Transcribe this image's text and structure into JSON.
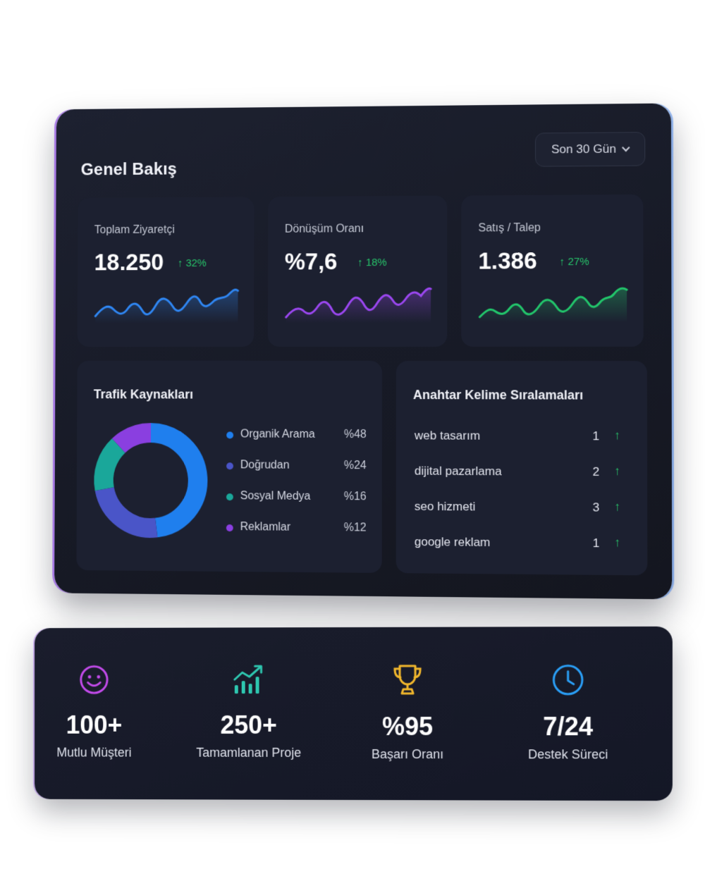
{
  "overview": {
    "title": "Genel Bakış",
    "range_label": "Son 30 Gün"
  },
  "kpis": [
    {
      "label": "Toplam Ziyaretçi",
      "value": "18.250",
      "delta": "↑ 32%",
      "color": "#2f86f2"
    },
    {
      "label": "Dönüşüm Oranı",
      "value": "%7,6",
      "delta": "↑ 18%",
      "color": "#9b47f0"
    },
    {
      "label": "Satış / Talep",
      "value": "1.386",
      "delta": "↑ 27%",
      "color": "#22c56b"
    }
  ],
  "traffic": {
    "title": "Trafik Kaynakları",
    "sources": [
      {
        "name": "Organik Arama",
        "pct": "%48",
        "share": 48,
        "color": "#1f7fee"
      },
      {
        "name": "Doğrudan",
        "pct": "%24",
        "share": 24,
        "color": "#4a55c8"
      },
      {
        "name": "Sosyal Medya",
        "pct": "%16",
        "share": 16,
        "color": "#1aa79a"
      },
      {
        "name": "Reklamlar",
        "pct": "%12",
        "share": 12,
        "color": "#8a3fe0"
      }
    ]
  },
  "keywords": {
    "title": "Anahtar Kelime Sıralamaları",
    "rows": [
      {
        "keyword": "web tasarım",
        "rank": "1",
        "trend": "↑"
      },
      {
        "keyword": "dijital pazarlama",
        "rank": "2",
        "trend": "↑"
      },
      {
        "keyword": "seo hizmeti",
        "rank": "3",
        "trend": "↑"
      },
      {
        "keyword": "google reklam",
        "rank": "1",
        "trend": "↑"
      }
    ]
  },
  "stats": [
    {
      "value": "100+",
      "caption": "Mutlu Müşteri",
      "icon": "smiley-icon",
      "color": "#c04ae8"
    },
    {
      "value": "250+",
      "caption": "Tamamlanan Proje",
      "icon": "growth-chart-icon",
      "color": "#2ec7b0"
    },
    {
      "value": "%95",
      "caption": "Başarı Oranı",
      "icon": "trophy-icon",
      "color": "#f1b72c"
    },
    {
      "value": "7/24",
      "caption": "Destek Süreci",
      "icon": "clock-icon",
      "color": "#2a9ef5"
    }
  ]
}
